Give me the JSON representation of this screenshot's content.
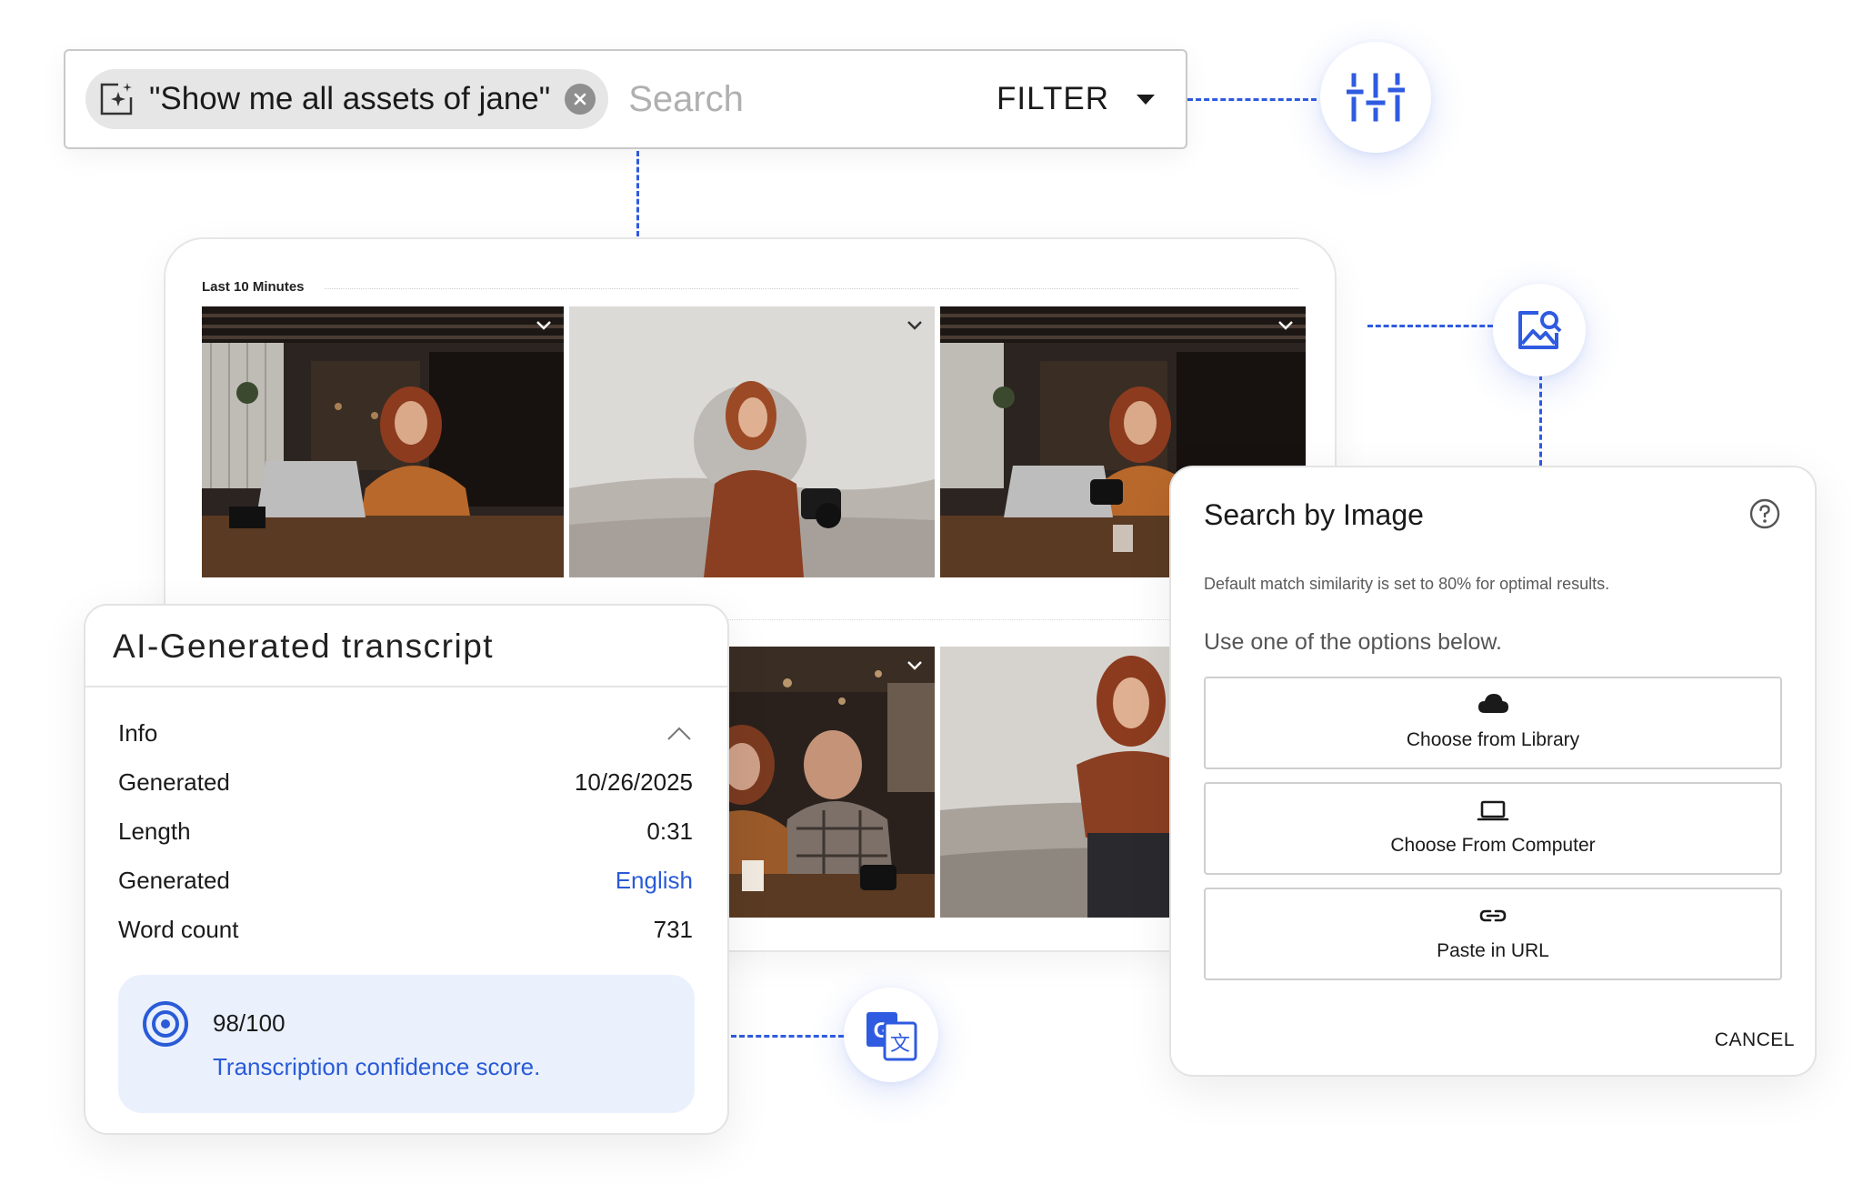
{
  "search": {
    "query_chip": "\"Show me all assets of jane\"",
    "placeholder": "Search",
    "filter_label": "FILTER"
  },
  "gallery": {
    "section_label": "Last 10 Minutes",
    "thumbnails": [
      {
        "scene": "cafe-laptop-drinking"
      },
      {
        "scene": "portrait-camera-face-highlight"
      },
      {
        "scene": "cafe-laptop-camera"
      },
      {
        "scene": "cafe-people-chatting"
      },
      {
        "scene": "portrait-standing"
      }
    ]
  },
  "transcript": {
    "title": "AI-Generated transcript",
    "info_label": "Info",
    "rows": [
      {
        "label": "Generated",
        "value": "10/26/2025"
      },
      {
        "label": "Length",
        "value": "0:31"
      },
      {
        "label": "Generated",
        "value": "English"
      },
      {
        "label": "Word count",
        "value": "731"
      }
    ],
    "score": "98/100",
    "score_caption": "Transcription confidence score."
  },
  "search_by_image": {
    "title": "Search by Image",
    "note": "Default match similarity is set to 80% for optimal results.",
    "hint": "Use one of the options below.",
    "options": [
      {
        "label": "Choose from Library",
        "icon": "cloud-icon"
      },
      {
        "label": "Choose From Computer",
        "icon": "laptop-icon"
      },
      {
        "label": "Paste in URL",
        "icon": "link-icon"
      }
    ],
    "cancel_label": "CANCEL"
  },
  "colors": {
    "accent_blue": "#2f5be0",
    "link_blue": "#2a5bd7",
    "score_bg": "#eaf1fd"
  }
}
